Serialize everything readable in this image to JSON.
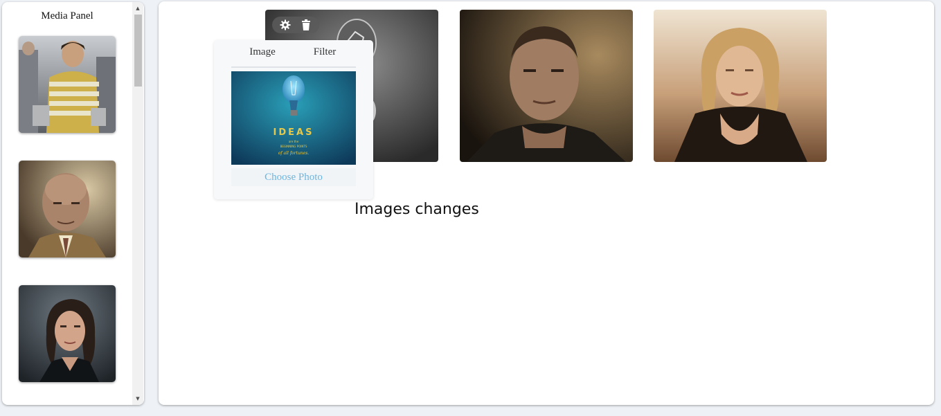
{
  "media_panel": {
    "title": "Media Panel",
    "items": [
      {
        "alt": "young man in striped shirt"
      },
      {
        "alt": "bald man in suit"
      },
      {
        "alt": "woman with dark hair"
      }
    ]
  },
  "canvas": {
    "photos": [
      {
        "alt": "photo with toolbar"
      },
      {
        "alt": "man with short hair"
      },
      {
        "alt": "blonde woman"
      }
    ],
    "toolbar": {
      "settings_icon": "gear-icon",
      "delete_icon": "trash-icon"
    },
    "popup": {
      "tabs": [
        "Image",
        "Filter"
      ],
      "preview_title": "IDEAS",
      "preview_sub1": "are the",
      "preview_sub2": "BEGINNING POINTS",
      "preview_sub3": "of all fortunes.",
      "choose_label": "Choose Photo"
    },
    "caption": "Images changes"
  },
  "colors": {
    "accent": "#6cb5e0",
    "panel_bg": "#ffffff",
    "page_bg": "#eef2f6"
  }
}
